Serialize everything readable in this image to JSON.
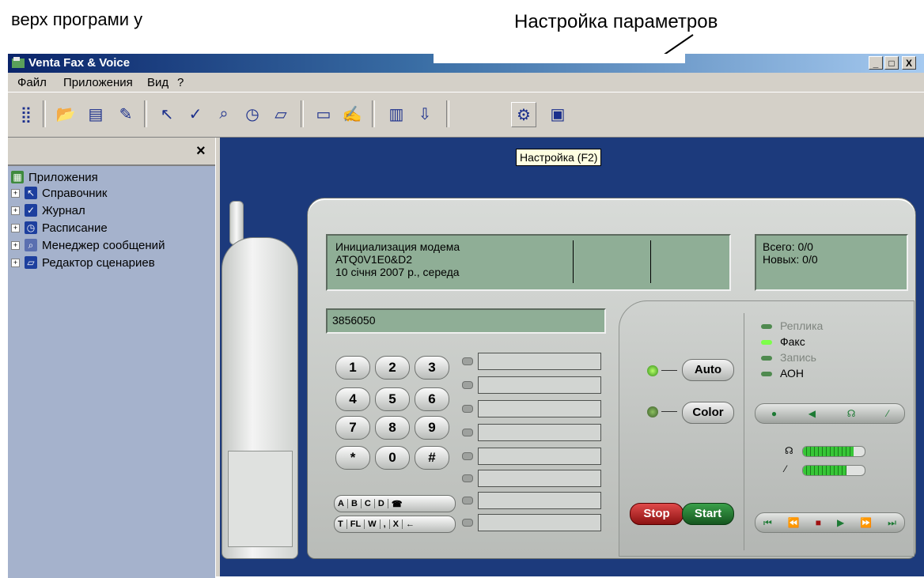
{
  "document": {
    "top_text": "верх програми у",
    "callout_label": "Настройка параметров"
  },
  "window": {
    "title": "Venta Fax & Voice",
    "controls": [
      "_",
      "□",
      "X"
    ]
  },
  "menu": [
    "Файл",
    "Приложения",
    "Вид",
    "?"
  ],
  "toolbar": {
    "icons": [
      "tree-view-icon",
      "open-folder-icon",
      "inbox-icon",
      "send-icon",
      "phone-icon",
      "check-icon",
      "search-icon",
      "clock-icon",
      "script-icon",
      "card-icon",
      "edit-icon",
      "report-icon",
      "export-icon",
      "settings-icon",
      "help-icon"
    ],
    "tooltip": "Настройка (F2)"
  },
  "leftpane": {
    "close": "×",
    "root": "Приложения",
    "items": [
      "Справочник",
      "Журнал",
      "Расписание",
      "Менеджер сообщений",
      "Редактор сценариев"
    ]
  },
  "device": {
    "lcd_lines": [
      "Инициализация модема",
      "ATQ0V1E0&D2",
      "10 січня 2007 р., середа"
    ],
    "counts": [
      "Всего:  0/0",
      "Новых: 0/0"
    ],
    "number": "3856050",
    "keys": [
      "1",
      "2",
      "3",
      "4",
      "5",
      "6",
      "7",
      "8",
      "9",
      "*",
      "0",
      "#"
    ],
    "abc_row1": [
      "A",
      "B",
      "C",
      "D",
      "☎"
    ],
    "abc_row2": [
      "T",
      "FL",
      "W",
      ",",
      "X",
      "←"
    ],
    "auto_label": "Auto",
    "color_label": "Color",
    "stop_label": "Stop",
    "start_label": "Start",
    "status": [
      "Реплика",
      "Факс",
      "Запись",
      "АОН"
    ],
    "meters": [
      0.82,
      0.7
    ]
  }
}
